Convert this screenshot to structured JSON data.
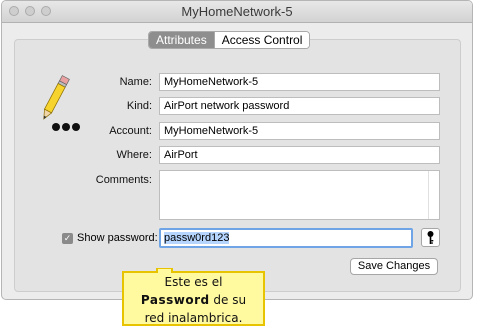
{
  "window": {
    "title": "MyHomeNetwork-5"
  },
  "tabs": [
    {
      "label": "Attributes",
      "selected": true
    },
    {
      "label": "Access Control",
      "selected": false
    }
  ],
  "form": {
    "name_label": "Name:",
    "name_value": "MyHomeNetwork-5",
    "kind_label": "Kind:",
    "kind_value": "AirPort network password",
    "account_label": "Account:",
    "account_value": "MyHomeNetwork-5",
    "where_label": "Where:",
    "where_value": "AirPort",
    "comments_label": "Comments:",
    "comments_value": "",
    "show_password_label": "Show password:",
    "show_password_checked": true,
    "password_value": "passw0rd123",
    "save_label": "Save Changes"
  },
  "callout": {
    "line1": "Este es el",
    "bold_word": "Password",
    "line2_rest": " de su",
    "line3": "red inalambrica."
  },
  "colors": {
    "callout_fill": "#fff9a0",
    "callout_border": "#e8c300",
    "focus_ring": "#6fa5e6"
  },
  "icons": {
    "app_icon": "pencil-icon",
    "key_button": "key-icon",
    "checkbox": "check-icon"
  }
}
